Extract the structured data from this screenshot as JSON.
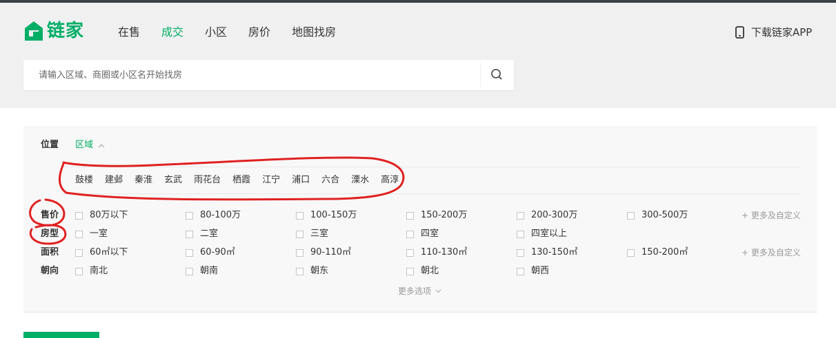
{
  "brand": {
    "logo_text": "链家",
    "accent_color": "#00ae66",
    "logo_icon": "house-logo-icon"
  },
  "nav": {
    "items": [
      "在售",
      "成交",
      "小区",
      "房价",
      "地图找房"
    ],
    "active_index": 1
  },
  "header": {
    "app_download": "下载链家APP",
    "app_icon": "phone-icon"
  },
  "search": {
    "placeholder": "请输入区域、商圈或小区名开始找房",
    "value": "",
    "icon": "search-icon"
  },
  "filters": {
    "location": {
      "label": "位置",
      "tab": "区域",
      "districts": [
        "鼓楼",
        "建邺",
        "秦淮",
        "玄武",
        "雨花台",
        "栖霞",
        "江宁",
        "浦口",
        "六合",
        "溧水",
        "高淳"
      ]
    },
    "price": {
      "label": "售价",
      "options": [
        "80万以下",
        "80-100万",
        "100-150万",
        "150-200万",
        "200-300万",
        "300-500万"
      ],
      "more": "+ 更多及自定义"
    },
    "room": {
      "label": "房型",
      "options": [
        "一室",
        "二室",
        "三室",
        "四室",
        "四室以上"
      ]
    },
    "area": {
      "label": "面积",
      "options": [
        "60㎡以下",
        "60-90㎡",
        "90-110㎡",
        "110-130㎡",
        "130-150㎡",
        "150-200㎡"
      ],
      "more": "+ 更多及自定义"
    },
    "orientation": {
      "label": "朝向",
      "options": [
        "南北",
        "朝南",
        "朝东",
        "朝北",
        "朝西"
      ]
    },
    "more_options": "更多选项"
  },
  "annotation_color": "#e02020"
}
